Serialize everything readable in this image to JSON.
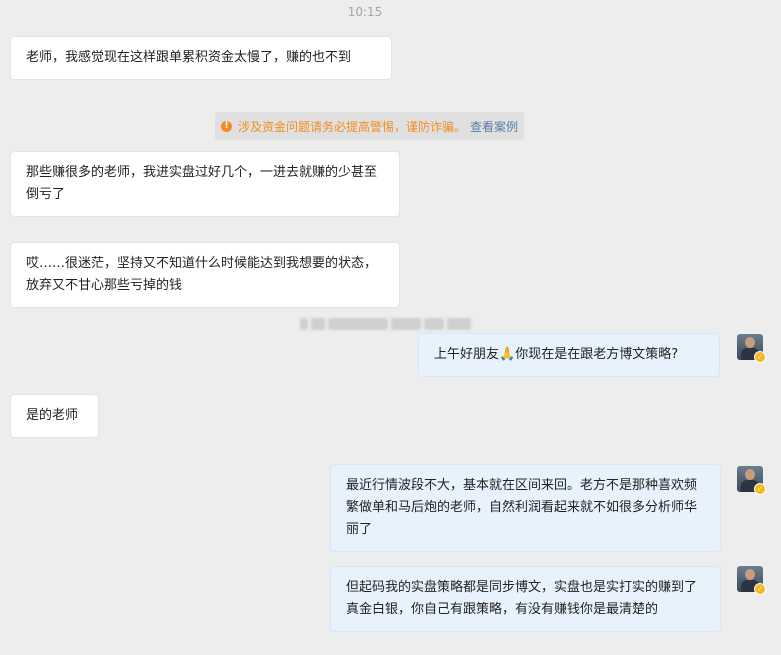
{
  "time": "10:15",
  "messages": [
    {
      "text": "老师，我感觉现在这样跟单累积资金太慢了，赚的也不到"
    },
    {
      "text": "那些赚很多的老师，我进实盘过好几个，一进去就赚的少甚至倒亏了"
    },
    {
      "text": "哎……很迷茫，坚持又不知道什么时候能达到我想要的状态，放弃又不甘心那些亏掉的钱"
    },
    {
      "text_before": "上午好朋友",
      "emoji": "🙏",
      "text_after": "你现在是在跟老方博文策略?"
    },
    {
      "text": "是的老师"
    },
    {
      "text": "最近行情波段不大，基本就在区间来回。老方不是那种喜欢频繁做单和马后炮的老师，自然利润看起来就不如很多分析师华丽了"
    },
    {
      "text": "但起码我的实盘策略都是同步博文，实盘也是实打实的赚到了真金白银，你自己有跟策略，有没有赚钱你是最清楚的"
    }
  ],
  "notice": {
    "icon": "warning-icon",
    "text": "涉及资金问题请务必提高警惕，谨防诈骗。",
    "link": "查看案例",
    "color": "#f28d22",
    "link_color": "#5b7da8"
  },
  "colors": {
    "background": "#ededed",
    "incoming_bubble": "#ffffff",
    "outgoing_bubble": "#e8f2fd"
  }
}
